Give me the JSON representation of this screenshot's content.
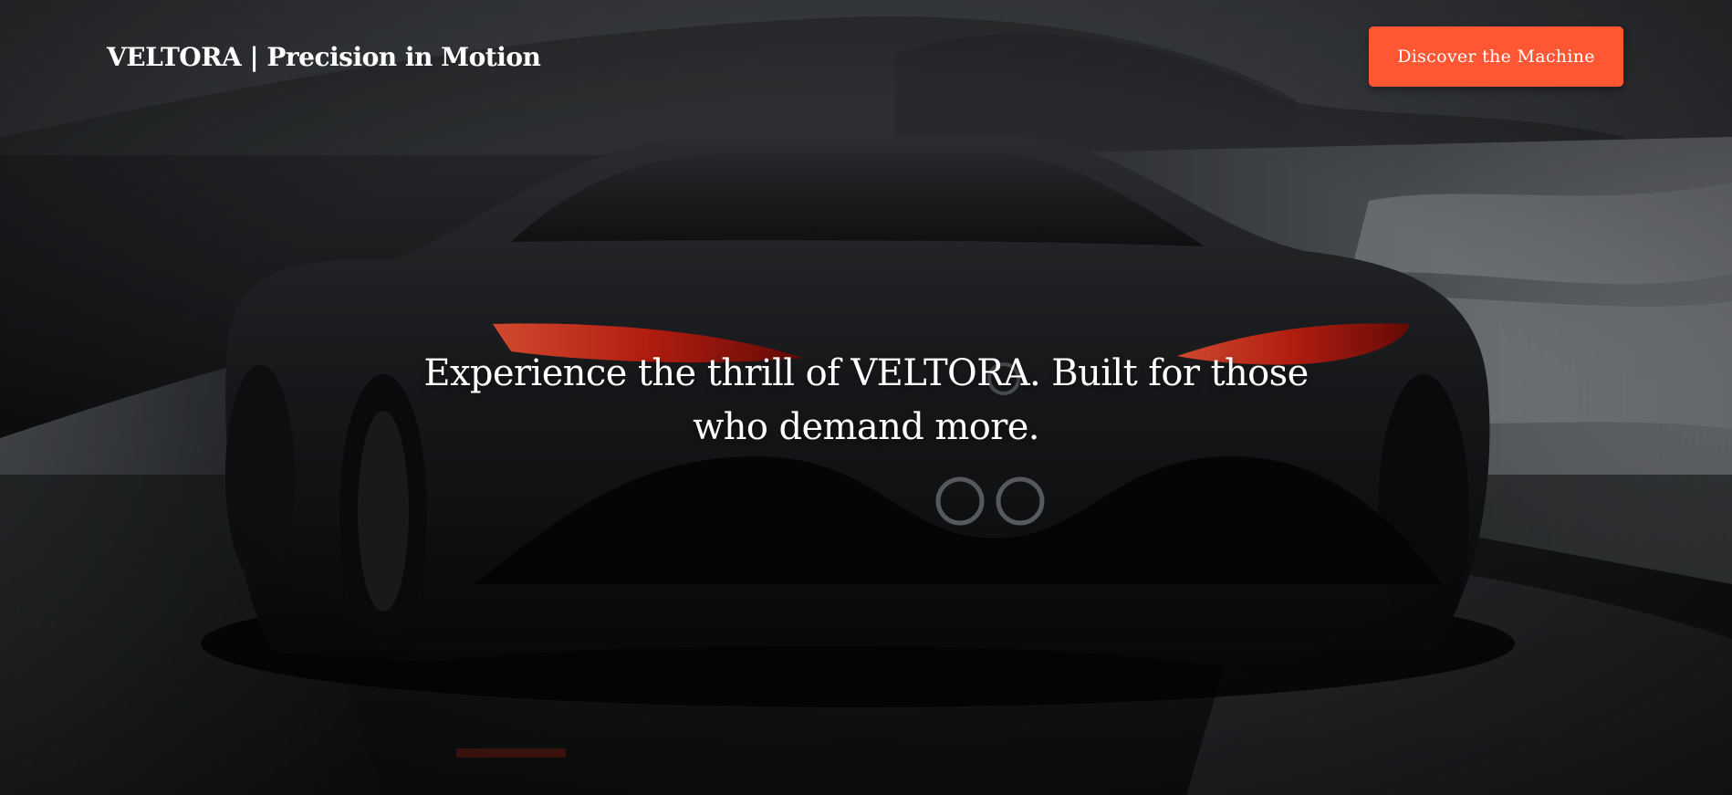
{
  "header": {
    "brand": "VELTORA | Precision in Motion",
    "cta_label": "Discover the Machine"
  },
  "hero": {
    "tagline": "Experience the thrill of VELTORA. Built for those who demand more.",
    "image": "hero-car-rear-wet-beach",
    "taillight_color": "#ff2a1a"
  },
  "colors": {
    "accent": "#ff5733",
    "text": "#ffffff"
  }
}
